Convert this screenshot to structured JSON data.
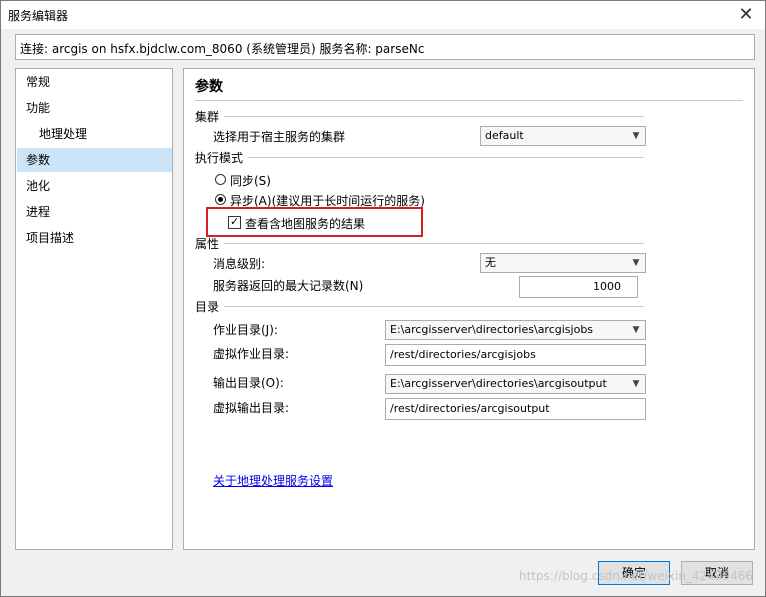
{
  "window": {
    "title": "服务编辑器",
    "close_icon": "close-icon"
  },
  "connection_info": "连接: arcgis on hsfx.bjdclw.com_8060 (系统管理员)    服务名称: parseNc",
  "nav": {
    "items": [
      {
        "label": "常规"
      },
      {
        "label": "功能"
      },
      {
        "label": "地理处理"
      },
      {
        "label": "参数"
      },
      {
        "label": "池化"
      },
      {
        "label": "进程"
      },
      {
        "label": "项目描述"
      }
    ]
  },
  "panel": {
    "title": "参数",
    "cluster": {
      "section": "集群",
      "label": "选择用于宿主服务的集群",
      "value": "default"
    },
    "exec_mode": {
      "section": "执行模式",
      "sync_label": "同步(S)",
      "async_label": "异步(A)(建议用于长时间运行的服务)",
      "selected": "async",
      "view_map_label": "查看含地图服务的结果",
      "view_map_checked": true
    },
    "properties": {
      "section": "属性",
      "message_level_label": "消息级别:",
      "message_level_value": "无",
      "max_records_label": "服务器返回的最大记录数(N)",
      "max_records_value": "1000"
    },
    "directories": {
      "section": "目录",
      "jobs_label": "作业目录(J):",
      "jobs_value": "E:\\arcgisserver\\directories\\arcgisjobs",
      "virtual_jobs_label": "虚拟作业目录:",
      "virtual_jobs_value": "/rest/directories/arcgisjobs",
      "output_label": "输出目录(O):",
      "output_value": "E:\\arcgisserver\\directories\\arcgisoutput",
      "virtual_output_label": "虚拟输出目录:",
      "virtual_output_value": "/rest/directories/arcgisoutput"
    },
    "about_link": "关于地理处理服务设置"
  },
  "buttons": {
    "ok": "确定",
    "cancel": "取消"
  },
  "watermark": "https://blog.csdn.net/weixin_42499466",
  "colors": {
    "highlight_border": "#d81e1e",
    "selected_nav": "#cce4f7",
    "link": "#0000ee"
  }
}
